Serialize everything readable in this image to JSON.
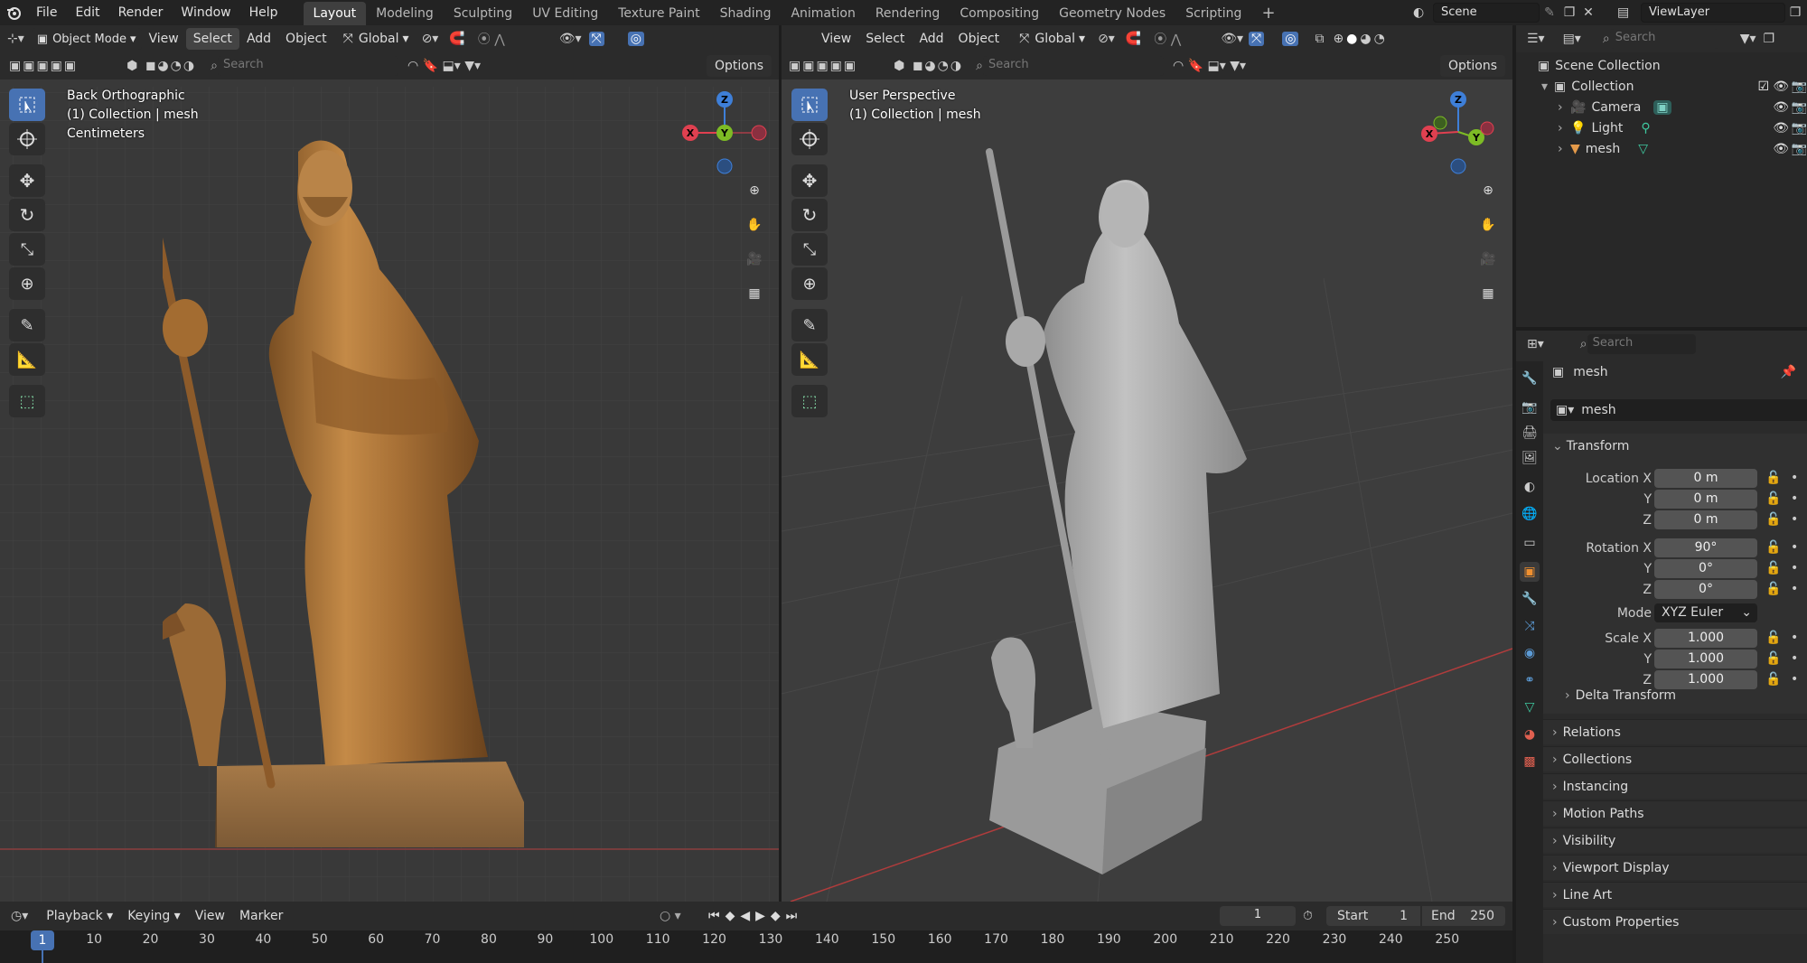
{
  "topbar": {
    "menus": [
      "File",
      "Edit",
      "Render",
      "Window",
      "Help"
    ],
    "workspaces": [
      "Layout",
      "Modeling",
      "Sculpting",
      "UV Editing",
      "Texture Paint",
      "Shading",
      "Animation",
      "Rendering",
      "Compositing",
      "Geometry Nodes",
      "Scripting"
    ],
    "active_workspace": "Layout",
    "add_tab": "+",
    "scene": "Scene",
    "view_layer": "ViewLayer"
  },
  "left_viewport": {
    "mode": "Object Mode",
    "menus": [
      "View",
      "Select",
      "Add",
      "Object"
    ],
    "highlighted_menu": "Select",
    "orientation": "Global",
    "search_placeholder": "Search",
    "options": "Options",
    "overlay": {
      "view": "Back Orthographic",
      "collection": "(1) Collection | mesh",
      "units": "Centimeters"
    },
    "gizmo": {
      "z": "Z",
      "x": "X",
      "y": "Y"
    },
    "render": "textured"
  },
  "right_viewport": {
    "menus": [
      "View",
      "Select",
      "Add",
      "Object"
    ],
    "orientation": "Global",
    "search_placeholder": "Search",
    "options": "Options",
    "overlay": {
      "view": "User Perspective",
      "collection": "(1) Collection | mesh"
    },
    "gizmo": {
      "z": "Z",
      "x": "X",
      "y": "Y"
    },
    "render": "solid"
  },
  "outliner": {
    "search_placeholder": "Search",
    "root": "Scene Collection",
    "collection": "Collection",
    "items": [
      {
        "name": "Camera",
        "icon": "camera-icon",
        "data_icon": "camera-data-icon"
      },
      {
        "name": "Light",
        "icon": "light-icon",
        "data_icon": "light-data-icon"
      },
      {
        "name": "mesh",
        "icon": "mesh-icon",
        "data_icon": "mesh-data-icon"
      }
    ]
  },
  "properties": {
    "search_placeholder": "Search",
    "object_name": "mesh",
    "datablock": "mesh",
    "transform": {
      "title": "Transform",
      "location_label": "Location X",
      "rotation_label": "Rotation X",
      "scale_label": "Scale X",
      "y_label": "Y",
      "z_label": "Z",
      "location": [
        "0 m",
        "0 m",
        "0 m"
      ],
      "rotation": [
        "90°",
        "0°",
        "0°"
      ],
      "mode_label": "Mode",
      "mode": "XYZ Euler",
      "scale": [
        "1.000",
        "1.000",
        "1.000"
      ],
      "delta": "Delta Transform"
    },
    "panels": [
      "Relations",
      "Collections",
      "Instancing",
      "Motion Paths",
      "Visibility",
      "Viewport Display",
      "Line Art",
      "Custom Properties"
    ]
  },
  "timeline": {
    "menus": [
      "Playback",
      "Keying",
      "View",
      "Marker"
    ],
    "current_frame": "1",
    "start_label": "Start",
    "start": "1",
    "end_label": "End",
    "end": "250",
    "ticks": [
      "1",
      "10",
      "20",
      "30",
      "40",
      "50",
      "60",
      "70",
      "80",
      "90",
      "100",
      "110",
      "120",
      "130",
      "140",
      "150",
      "160",
      "170",
      "180",
      "190",
      "200",
      "210",
      "220",
      "230",
      "240",
      "250"
    ]
  },
  "colors": {
    "accent": "#4772b3",
    "gizmo_x": "#e04050",
    "gizmo_y": "#7dbb25",
    "gizmo_z": "#3e7fd8",
    "statue_wood": "#b07a3c",
    "statue_solid": "#a8a8a8"
  }
}
